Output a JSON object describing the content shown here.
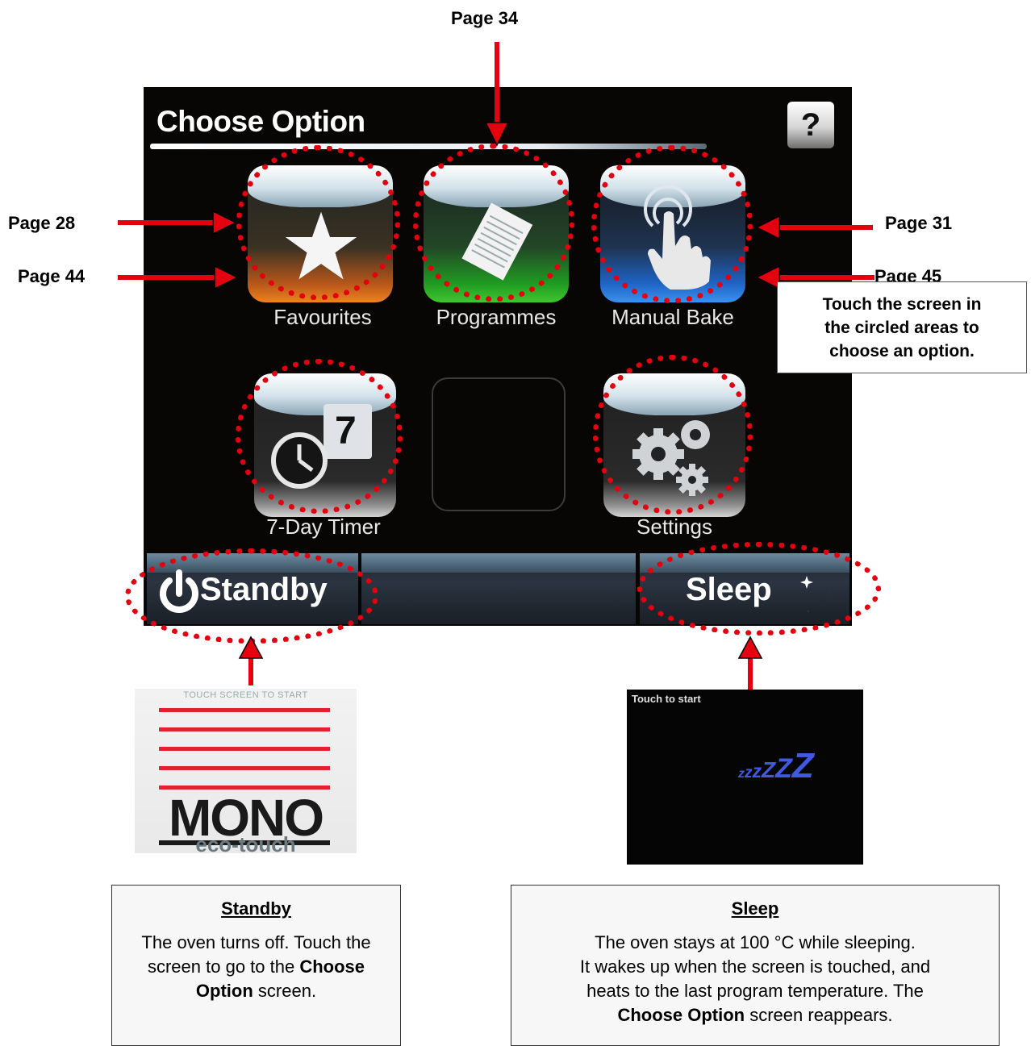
{
  "page_refs": {
    "programmes": "Page 34",
    "favourites": "Page 28",
    "manual_bake": "Page 31",
    "timer": "Page 44",
    "settings": "Page 45"
  },
  "screen": {
    "title": "Choose Option",
    "help_label": "?",
    "tiles": {
      "favourites": "Favourites",
      "programmes": "Programmes",
      "manual_bake": "Manual Bake",
      "timer": "7-Day Timer",
      "timer_calendar_digit": "7",
      "settings": "Settings"
    },
    "standby_label": "Standby",
    "sleep_label": "Sleep"
  },
  "instruction": {
    "line1": "Touch the screen in",
    "line2": "the circled areas to",
    "line3": "choose an option."
  },
  "standby_screen": {
    "top_text": "TOUCH SCREEN TO START",
    "logo": "MONO",
    "tagline": "eco-touch"
  },
  "sleep_screen": {
    "top_text": "Touch to start",
    "zzz": "zzzZZZ"
  },
  "standby_info": {
    "title": "Standby",
    "text_1": "The oven turns off. Touch the screen to go to the ",
    "bold": "Choose Option",
    "text_2": " screen."
  },
  "sleep_info": {
    "title": "Sleep",
    "line1": "The oven stays at 100 °C while sleeping.",
    "line2": "It wakes up when the screen is touched, and",
    "line3": "heats to the last program temperature. The",
    "bold": "Choose Option",
    "text_2": " screen reappears."
  },
  "colors": {
    "arrow_red": "#e4000f",
    "favourites_glow": "#e8610f",
    "programmes_glow": "#2fbd2a",
    "manual_bake_glow": "#2f7ee0",
    "sleep_blue": "#3f59e0"
  }
}
